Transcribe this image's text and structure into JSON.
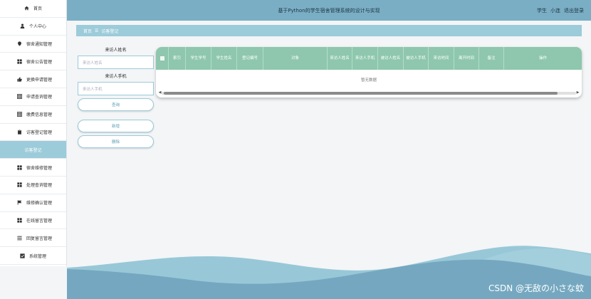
{
  "header": {
    "title": "基于Python的学生宿舍管理系统的设计与实现",
    "role": "学生",
    "user": "小连",
    "logout": "退出登录"
  },
  "sidebar": {
    "items": [
      {
        "label": "首页",
        "icon": "home-icon"
      },
      {
        "label": "个人中心",
        "icon": "user-icon"
      },
      {
        "label": "宿舍通知管理",
        "icon": "pin-icon"
      },
      {
        "label": "宿舍公告管理",
        "icon": "grid-icon"
      },
      {
        "label": "更换申请管理",
        "icon": "thumb-icon"
      },
      {
        "label": "申请查询管理",
        "icon": "table-icon"
      },
      {
        "label": "缴费信息管理",
        "icon": "table-icon"
      },
      {
        "label": "访客登记管理",
        "icon": "clipboard-icon"
      },
      {
        "label": "访客登记",
        "icon": "none",
        "active": true
      },
      {
        "label": "宿舍维修管理",
        "icon": "grid-icon"
      },
      {
        "label": "处理查询管理",
        "icon": "grid-icon"
      },
      {
        "label": "维修确认管理",
        "icon": "flag-icon"
      },
      {
        "label": "在线留言管理",
        "icon": "grid-icon"
      },
      {
        "label": "回复留言管理",
        "icon": "list-icon"
      },
      {
        "label": "系统管理",
        "icon": "check-icon"
      }
    ]
  },
  "breadcrumb": {
    "home": "首页",
    "separator": "☰",
    "current": "访客登记"
  },
  "form": {
    "name_label": "来访人姓名",
    "name_placeholder": "来访人姓名",
    "phone_label": "来访人手机",
    "phone_placeholder": "来访人手机",
    "query": "查询",
    "add": "新增",
    "delete": "删除"
  },
  "table": {
    "columns": [
      "索引",
      "学生学号",
      "学生姓名",
      "登记编号",
      "对象",
      "来访人姓名",
      "来访人手机",
      "被访人姓名",
      "被访人手机",
      "来访时间",
      "离开时间",
      "备注",
      "操作"
    ],
    "empty": "暂无数据"
  },
  "watermark": "CSDN @无敌の小さな蚊",
  "colors": {
    "header": "#7aaec4",
    "accent": "#9ccbd9",
    "table_header": "#8ec7ad"
  }
}
